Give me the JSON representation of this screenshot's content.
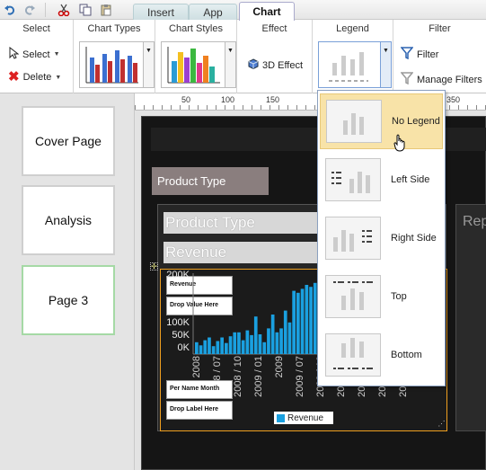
{
  "quick_access": {
    "undo_icon": "undo-icon",
    "redo_icon": "redo-icon",
    "cut_icon": "cut-icon",
    "copy_icon": "copy-icon",
    "paste_icon": "paste-icon"
  },
  "tabs": [
    {
      "label": "Insert"
    },
    {
      "label": "App"
    },
    {
      "label": "Chart"
    }
  ],
  "ribbon": {
    "select_group": {
      "title": "Select",
      "select_label": "Select",
      "delete_label": "Delete"
    },
    "chart_types_group": {
      "title": "Chart Types"
    },
    "chart_styles_group": {
      "title": "Chart Styles"
    },
    "effect_group": {
      "title": "Effect",
      "effect_label": "3D Effect"
    },
    "legend_group": {
      "title": "Legend"
    },
    "filter_group": {
      "title": "Filter",
      "filter_label": "Filter",
      "manage_label": "Manage Filters"
    }
  },
  "ruler": {
    "labels": [
      "50",
      "100",
      "150",
      "350"
    ]
  },
  "pages": [
    {
      "label": "Cover Page"
    },
    {
      "label": "Analysis"
    },
    {
      "label": "Page 3"
    }
  ],
  "report": {
    "product_type_box": "Product Type",
    "band_product": "Product Type",
    "band_revenue": "Revenue",
    "value_label": "Revenue",
    "drop_value": "Drop Value Here",
    "axis_label": "Per Name Month",
    "drop_label": "Drop Label Here",
    "legend_text": "Revenue",
    "legend_color": "#1aa0e0",
    "right_panel_title": "Rep"
  },
  "chart_data": {
    "type": "bar",
    "y_tick_labels": [
      "200K",
      "100K",
      "50K",
      "0K"
    ],
    "x_tick_labels": [
      "2008",
      "2008 / 07",
      "2008 / 10",
      "2009 / 01",
      "2009",
      "2009 / 07",
      "2009 / 10",
      "2010 / 01",
      "2010 / 04",
      "2010 / 07",
      "2010 / 10"
    ],
    "series": [
      {
        "name": "Revenue",
        "values": [
          30,
          22,
          35,
          42,
          20,
          33,
          42,
          28,
          45,
          55,
          55,
          35,
          60,
          48,
          95,
          50,
          30,
          65,
          100,
          55,
          65,
          110,
          80,
          160,
          155,
          165,
          175,
          170,
          180,
          175,
          200
        ]
      }
    ],
    "ylim": [
      0,
      200
    ],
    "legend": "bottom",
    "color": "#1aa0e0"
  },
  "legend_menu": {
    "items": [
      {
        "label": "No Legend",
        "icon": "no-legend-icon"
      },
      {
        "label": "Left Side",
        "icon": "legend-left-icon"
      },
      {
        "label": "Right Side",
        "icon": "legend-right-icon"
      },
      {
        "label": "Top",
        "icon": "legend-top-icon"
      },
      {
        "label": "Bottom",
        "icon": "legend-bottom-icon"
      }
    ],
    "hover_color": "#f8e3a8"
  }
}
